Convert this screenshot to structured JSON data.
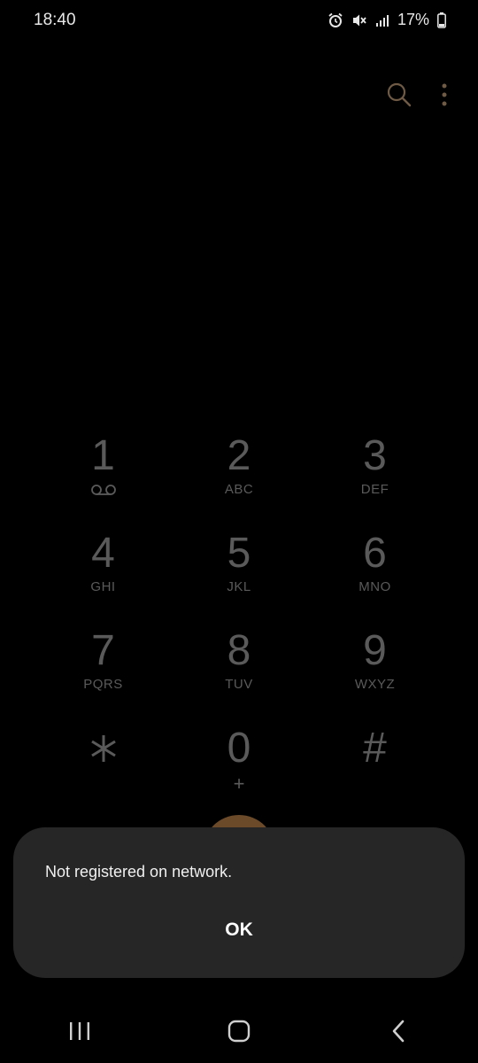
{
  "status_bar": {
    "time": "18:40",
    "battery": "17%",
    "icons": [
      "alarm-icon",
      "mute-icon",
      "signal-icon",
      "battery-icon"
    ]
  },
  "toolbar": {
    "icons": [
      "search-icon",
      "more-options-icon"
    ]
  },
  "dialpad": {
    "rows": [
      [
        {
          "digit": "1",
          "letters": ""
        },
        {
          "digit": "2",
          "letters": "ABC"
        },
        {
          "digit": "3",
          "letters": "DEF"
        }
      ],
      [
        {
          "digit": "4",
          "letters": "GHI"
        },
        {
          "digit": "5",
          "letters": "JKL"
        },
        {
          "digit": "6",
          "letters": "MNO"
        }
      ],
      [
        {
          "digit": "7",
          "letters": "PQRS"
        },
        {
          "digit": "8",
          "letters": "TUV"
        },
        {
          "digit": "9",
          "letters": "WXYZ"
        }
      ],
      [
        {
          "digit": "*",
          "letters": ""
        },
        {
          "digit": "0",
          "letters": "+"
        },
        {
          "digit": "#",
          "letters": ""
        }
      ]
    ]
  },
  "dialog": {
    "message": "Not registered on network.",
    "ok_label": "OK"
  },
  "nav_bar": {
    "icons": [
      "recent-apps-icon",
      "home-icon",
      "back-icon"
    ]
  },
  "colors": {
    "background": "#000000",
    "dialog_bg": "#262626",
    "key_text": "#5a5a5a",
    "call_button": "#6b4a2a",
    "toolbar_icon": "#6e5a45"
  }
}
